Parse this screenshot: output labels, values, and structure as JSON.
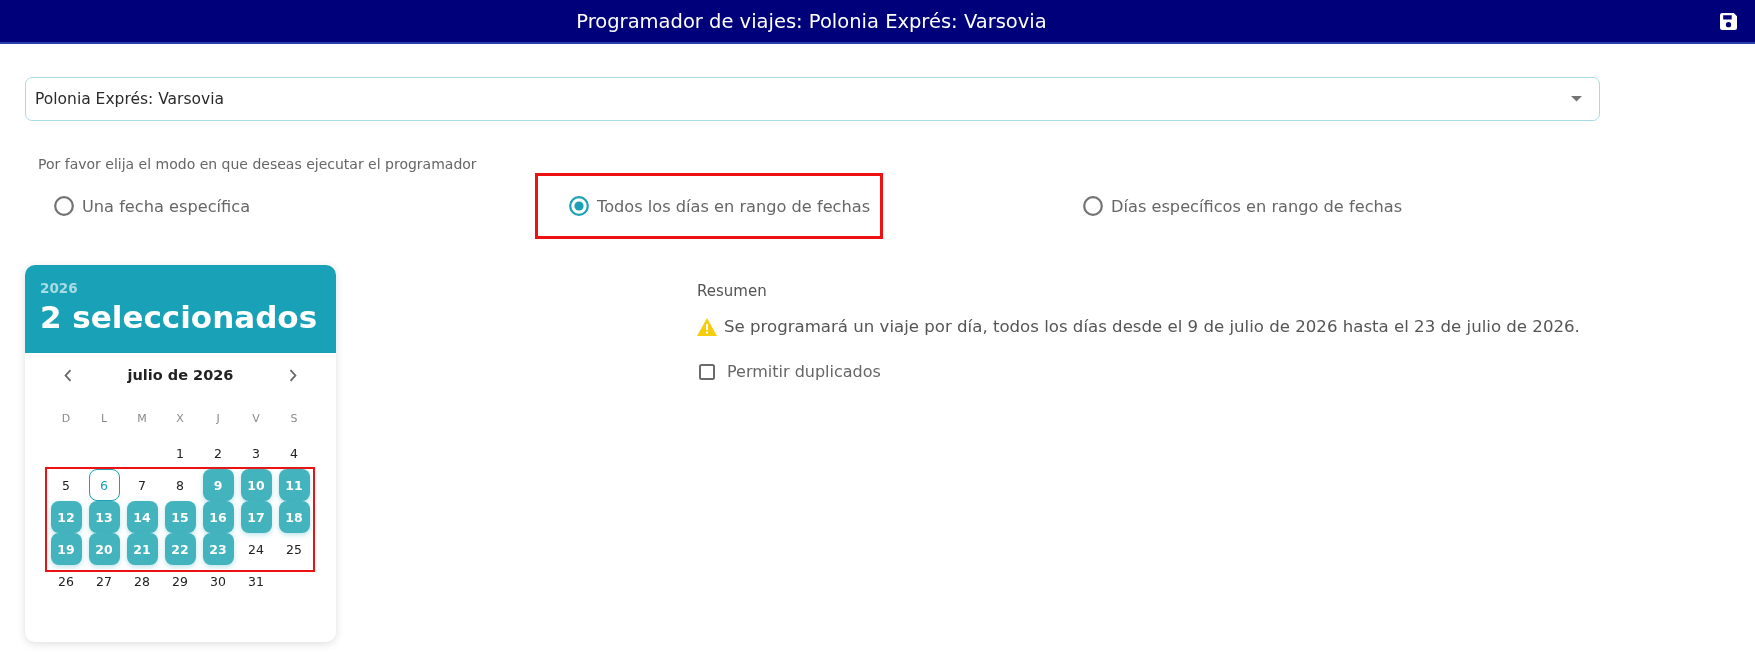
{
  "header": {
    "title": "Programador de viajes: Polonia Exprés: Varsovia"
  },
  "route_select": {
    "value": "Polonia Exprés: Varsovia"
  },
  "mode": {
    "prompt": "Por favor elija el modo en que deseas ejecutar el programador",
    "options": [
      {
        "label": "Una fecha específica",
        "selected": false,
        "highlighted": false
      },
      {
        "label": "Todos los días en rango de fechas",
        "selected": true,
        "highlighted": true
      },
      {
        "label": "Días específicos en rango de fechas",
        "selected": false,
        "highlighted": false
      }
    ]
  },
  "calendar": {
    "year": "2026",
    "headline": "2 seleccionados",
    "month_title": "julio de 2026",
    "weekdays": [
      "D",
      "L",
      "M",
      "X",
      "J",
      "V",
      "S"
    ],
    "weeks": [
      {
        "highlighted": false,
        "days": [
          {
            "label": "1",
            "selected": false,
            "today": false
          },
          {
            "label": "2",
            "selected": false,
            "today": false
          },
          {
            "label": "3",
            "selected": false,
            "today": false
          },
          {
            "label": "4",
            "selected": false,
            "today": false
          }
        ]
      },
      {
        "highlighted": true,
        "days": [
          {
            "label": "5",
            "selected": false,
            "today": false
          },
          {
            "label": "6",
            "selected": false,
            "today": true
          },
          {
            "label": "7",
            "selected": false,
            "today": false
          },
          {
            "label": "8",
            "selected": false,
            "today": false
          },
          {
            "label": "9",
            "selected": true,
            "today": false
          },
          {
            "label": "10",
            "selected": true,
            "today": false
          },
          {
            "label": "11",
            "selected": true,
            "today": false
          }
        ]
      },
      {
        "highlighted": true,
        "days": [
          {
            "label": "12",
            "selected": true,
            "today": false
          },
          {
            "label": "13",
            "selected": true,
            "today": false
          },
          {
            "label": "14",
            "selected": true,
            "today": false
          },
          {
            "label": "15",
            "selected": true,
            "today": false
          },
          {
            "label": "16",
            "selected": true,
            "today": false
          },
          {
            "label": "17",
            "selected": true,
            "today": false
          },
          {
            "label": "18",
            "selected": true,
            "today": false
          }
        ]
      },
      {
        "highlighted": true,
        "days": [
          {
            "label": "19",
            "selected": true,
            "today": false
          },
          {
            "label": "20",
            "selected": true,
            "today": false
          },
          {
            "label": "21",
            "selected": true,
            "today": false
          },
          {
            "label": "22",
            "selected": true,
            "today": false
          },
          {
            "label": "23",
            "selected": true,
            "today": false
          },
          {
            "label": "24",
            "selected": false,
            "today": false
          },
          {
            "label": "25",
            "selected": false,
            "today": false
          }
        ]
      },
      {
        "highlighted": false,
        "days": [
          {
            "label": "26",
            "selected": false,
            "today": false
          },
          {
            "label": "27",
            "selected": false,
            "today": false
          },
          {
            "label": "28",
            "selected": false,
            "today": false
          },
          {
            "label": "29",
            "selected": false,
            "today": false
          },
          {
            "label": "30",
            "selected": false,
            "today": false
          },
          {
            "label": "31",
            "selected": false,
            "today": false
          }
        ]
      }
    ]
  },
  "summary": {
    "title": "Resumen",
    "message": "Se programará un viaje por día, todos los días desde el 9 de julio de 2026 hasta el 23 de julio de 2026.",
    "allow_duplicates": {
      "label": "Permitir duplicados",
      "checked": false
    }
  }
}
